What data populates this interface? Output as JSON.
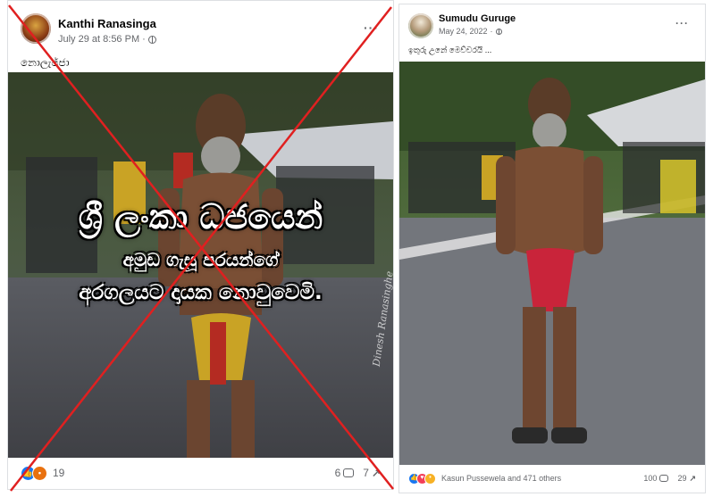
{
  "posts": [
    {
      "author": "Kanthi Ranasinga",
      "timestamp": "July 29 at 8:56 PM",
      "caption": "නොලැජ්ජා",
      "overlay": {
        "line1": "ශ්‍රී ලංකා ධජයෙන්",
        "line2": "අමුඩ ගැසූ පරයන්ගේ",
        "line3": "අරගලයට දායක නොවුවෙමි.",
        "watermark": "Dinesh Ranasinghe"
      },
      "reactions": {
        "icons": [
          "like-icon",
          "angry-icon"
        ],
        "count": "19"
      },
      "comments": "6",
      "shares": "7"
    },
    {
      "author": "Sumudu Guruge",
      "timestamp": "May 24, 2022",
      "caption": "ඉතුරු උනේ මෙච්චරයි ...",
      "reactions": {
        "icons": [
          "like-icon",
          "love-icon",
          "haha-icon"
        ],
        "text": "Kasun Pussewela and 471 others"
      },
      "comments": "100",
      "shares": "29"
    }
  ],
  "colors": {
    "accent": "#1877f2",
    "cross": "#e02020",
    "muted": "#65676b"
  }
}
